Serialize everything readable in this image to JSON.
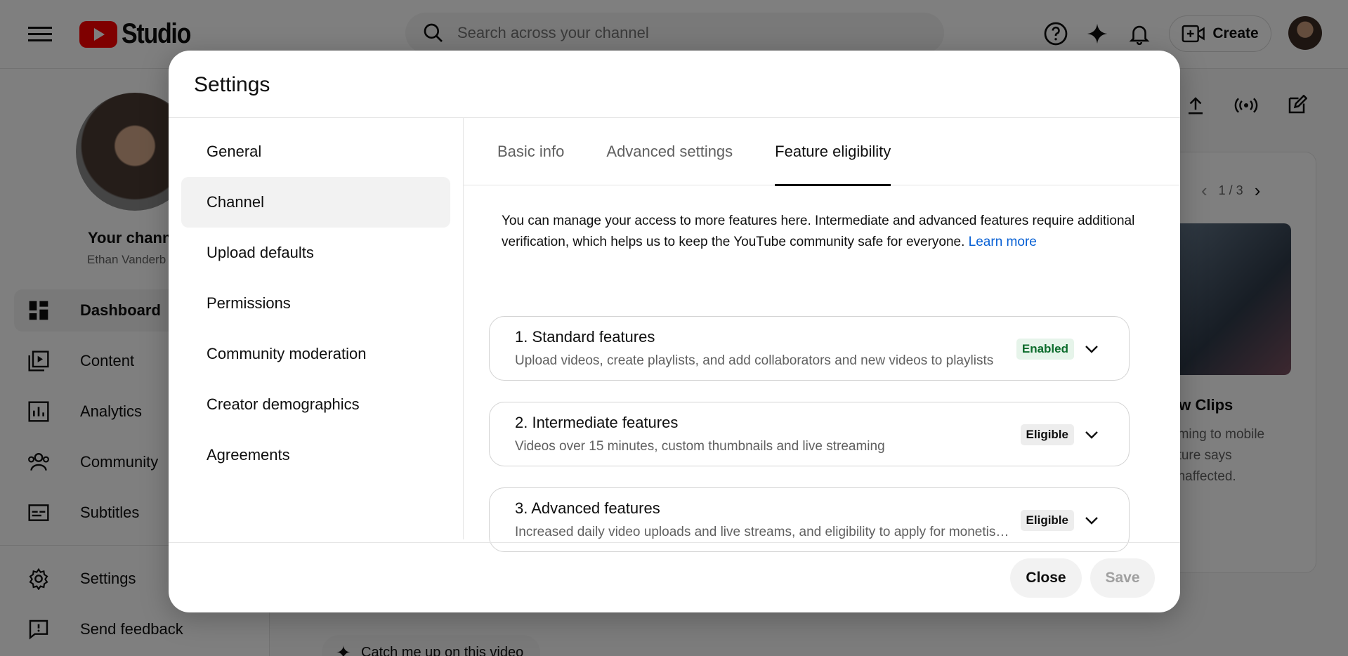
{
  "header": {
    "logo_text": "Studio",
    "search_placeholder": "Search across your channel",
    "create_label": "Create",
    "icons": [
      "help-icon",
      "sparkle-icon",
      "bell-icon",
      "create-video-icon"
    ]
  },
  "sidebar": {
    "channel_name": "Your chann",
    "channel_handle": "Ethan Vanderb",
    "items": [
      {
        "label": "Dashboard",
        "icon": "dashboard-icon"
      },
      {
        "label": "Content",
        "icon": "content-icon"
      },
      {
        "label": "Analytics",
        "icon": "analytics-icon"
      },
      {
        "label": "Community",
        "icon": "community-icon"
      },
      {
        "label": "Subtitles",
        "icon": "subtitles-icon"
      },
      {
        "label": "Settings",
        "icon": "gear-icon"
      },
      {
        "label": "Send feedback",
        "icon": "feedback-icon"
      }
    ]
  },
  "background": {
    "pager": "1 / 3",
    "news_title": "ew Clips",
    "news_lines": [
      "oming to mobile",
      "ature says",
      "unaffected."
    ],
    "bottom_chip": "Catch me up on this video"
  },
  "modal": {
    "title": "Settings",
    "nav": [
      "General",
      "Channel",
      "Upload defaults",
      "Permissions",
      "Community moderation",
      "Creator demographics",
      "Agreements"
    ],
    "tabs": [
      "Basic info",
      "Advanced settings",
      "Feature eligibility"
    ],
    "intro": "You can manage your access to more features here. Intermediate and advanced features require additional verification, which helps us to keep the YouTube community safe for everyone.",
    "learn_more": "Learn more",
    "features": [
      {
        "title": "1. Standard features",
        "desc": "Upload videos, create playlists, and add collaborators and new videos to playlists",
        "badge": "Enabled"
      },
      {
        "title": "2. Intermediate features",
        "desc": "Videos over 15 minutes, custom thumbnails and live streaming",
        "badge": "Eligible"
      },
      {
        "title": "3. Advanced features",
        "desc": "Increased daily video uploads and live streams, and eligibility to apply for monetisation",
        "badge": "Eligible"
      }
    ],
    "close_label": "Close",
    "save_label": "Save"
  },
  "colors": {
    "brand": "#ff0000",
    "link": "#065fd4",
    "enabled_bg": "#e6f4ea",
    "enabled_text": "#0b6b2b"
  }
}
